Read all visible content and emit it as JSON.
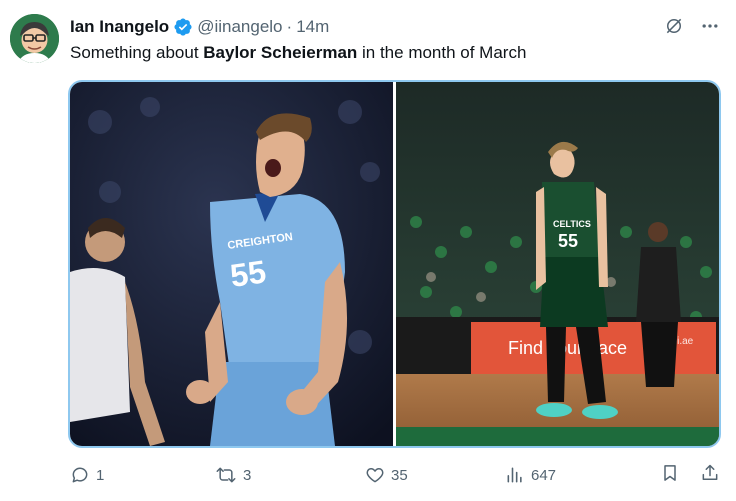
{
  "author": {
    "name": "Ian Inangelo",
    "handle": "@iinangelo",
    "separator": "·",
    "time": "14m",
    "avatar_icon": "avatar-cartoon",
    "verified_icon": "verified-badge-icon"
  },
  "tweet": {
    "text_before": "Something about ",
    "text_bold": "Baylor Scheierman",
    "text_after": " in the month of March"
  },
  "media": {
    "photos": [
      {
        "name": "photo-creighton",
        "jersey_team": "CREIGHTON",
        "jersey_number": "55"
      },
      {
        "name": "photo-celtics",
        "jersey_team": "CELTICS",
        "jersey_number": "55",
        "banner_text": "Find your pace",
        "banner_side_text": "abi.ae"
      }
    ]
  },
  "actions": {
    "reply_count": "1",
    "retweet_count": "3",
    "like_count": "35",
    "view_count": "647"
  },
  "colors": {
    "accent": "#1d9bf0",
    "muted": "#536471",
    "media_border": "#8ec8ef"
  }
}
